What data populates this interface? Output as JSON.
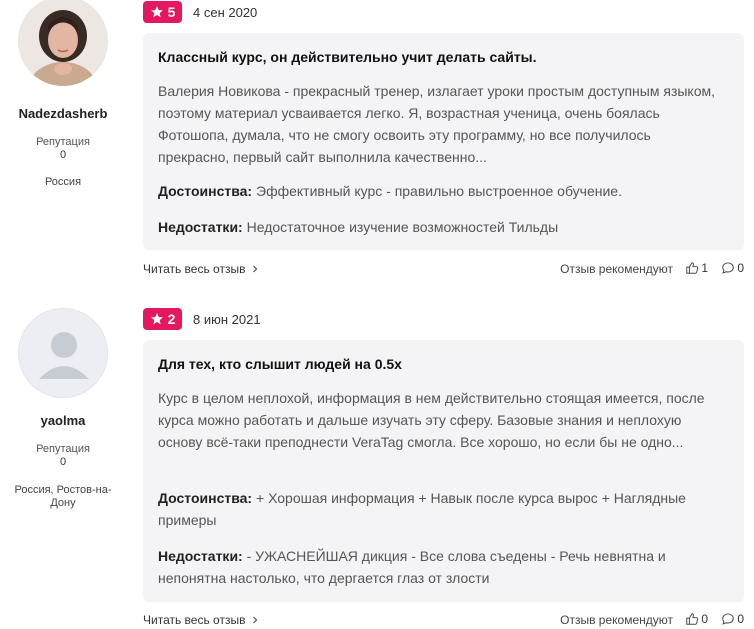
{
  "reviews": [
    {
      "author": {
        "name": "Nadezdasherb",
        "reputation_label": "Репутация",
        "reputation_value": "0",
        "location": "Россия"
      },
      "rating": "5",
      "date": "4 сен 2020",
      "title": "Классный курс, он действительно учит делать сайты.",
      "text": "Валерия Новикова - прекрасный тренер, излагает уроки простым доступным языком, поэтому материал усваивается легко. Я, возрастная ученица, очень боялась Фотошопа, думала, что не смогу освоить эту программу, но все получилось прекрасно, первый сайт выполнила качественно...",
      "pros_label": "Достоинства:",
      "pros": "Эффективный курс - правильно выстроенное обучение.",
      "cons_label": "Недостатки:",
      "cons": "Недостаточное изучение возможностей Тильды",
      "read_more": "Читать весь отзыв",
      "recommend": "Отзыв рекомендуют",
      "likes": "1",
      "comments": "0"
    },
    {
      "author": {
        "name": "yaolma",
        "reputation_label": "Репутация",
        "reputation_value": "0",
        "location": "Россия, Ростов-на-Дону"
      },
      "rating": "2",
      "date": "8 июн 2021",
      "title": "Для тех, кто слышит людей на 0.5х",
      "text": "Курс в целом неплохой, информация в нем действительно стоящая имеется, после курса можно работать и дальше изучать эту сферу. Базовые знания и неплохую основу всё-таки преподнести VeraTag смогла. Все хорошо, но если бы не одно...",
      "pros_label": "Достоинства:",
      "pros": "+ Хорошая информация + Навык после курса вырос + Наглядные примеры",
      "cons_label": "Недостатки:",
      "cons": "- УЖАСНЕЙШАЯ дикция - Все слова съедены - Речь невнятна и непонятна настолько, что дергается глаз от злости",
      "read_more": "Читать весь отзыв",
      "recommend": "Отзыв рекомендуют",
      "likes": "0",
      "comments": "0"
    }
  ],
  "icons": {
    "badge_star": "star-icon",
    "read_more": "chevron-right-icon",
    "like": "thumbs-up-icon",
    "comment": "comment-icon"
  },
  "colors": {
    "accent": "#e5175e",
    "card_bg": "#f4f4f6"
  }
}
